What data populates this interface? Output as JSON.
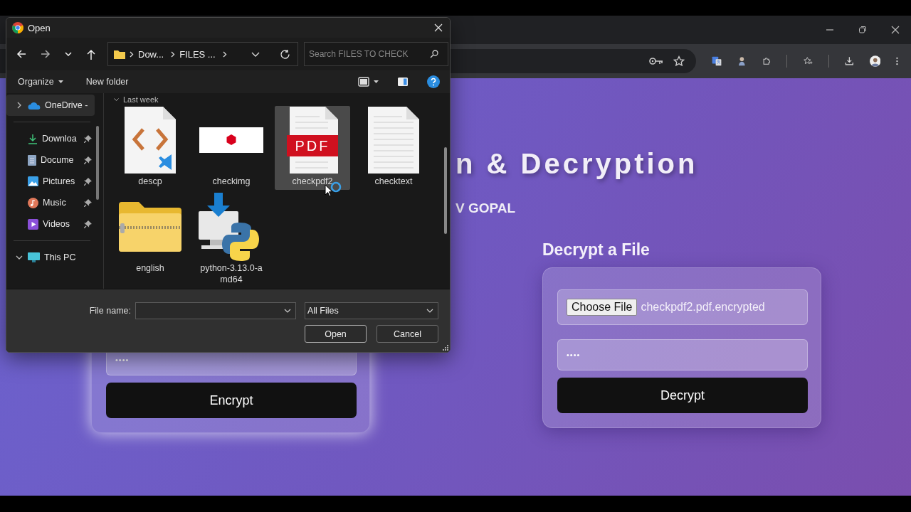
{
  "page": {
    "title": "n & Decryption",
    "subtitle": "V GOPAL",
    "encrypt_card": {
      "password": "••••",
      "button": "Encrypt"
    },
    "decrypt_card": {
      "heading": "Decrypt a File",
      "choose_button": "Choose File",
      "file_name": "checkpdf2.pdf.encrypted",
      "password": "••••",
      "button": "Decrypt"
    }
  },
  "dialog": {
    "title": "Open",
    "breadcrumb": [
      "Dow...",
      "FILES ..."
    ],
    "search": {
      "placeholder": "Search FILES TO CHECK"
    },
    "organize": "Organize",
    "new_folder": "New folder",
    "sidebar": [
      {
        "kind": "cloud",
        "label": "OneDrive -",
        "expanded": false,
        "selected": true
      },
      {
        "kind": "downloads",
        "label": "Downloa",
        "pinned": true,
        "selected": false
      },
      {
        "kind": "documents",
        "label": "Docume",
        "pinned": true,
        "selected": false
      },
      {
        "kind": "pictures",
        "label": "Pictures",
        "pinned": true,
        "selected": false
      },
      {
        "kind": "music",
        "label": "Music",
        "pinned": true,
        "selected": false
      },
      {
        "kind": "videos",
        "label": "Videos",
        "pinned": true,
        "selected": false
      },
      {
        "kind": "pc",
        "label": "This PC",
        "expanded": true,
        "selected": false
      }
    ],
    "group": {
      "label": "Last week",
      "expanded": true
    },
    "files": [
      {
        "name": "descp",
        "kind": "code",
        "selected": false
      },
      {
        "name": "checkimg",
        "kind": "image",
        "selected": false
      },
      {
        "name": "checkpdf2",
        "kind": "pdf",
        "badge": "PDF",
        "selected": true
      },
      {
        "name": "checktext",
        "kind": "text",
        "selected": false
      },
      {
        "name": "english",
        "kind": "zip",
        "selected": false
      },
      {
        "name": "python-3.13.0-amd64",
        "kind": "installer",
        "selected": false
      }
    ],
    "file_name_label": "File name:",
    "file_type": "All Files",
    "buttons": [
      "Open",
      "Cancel"
    ]
  }
}
